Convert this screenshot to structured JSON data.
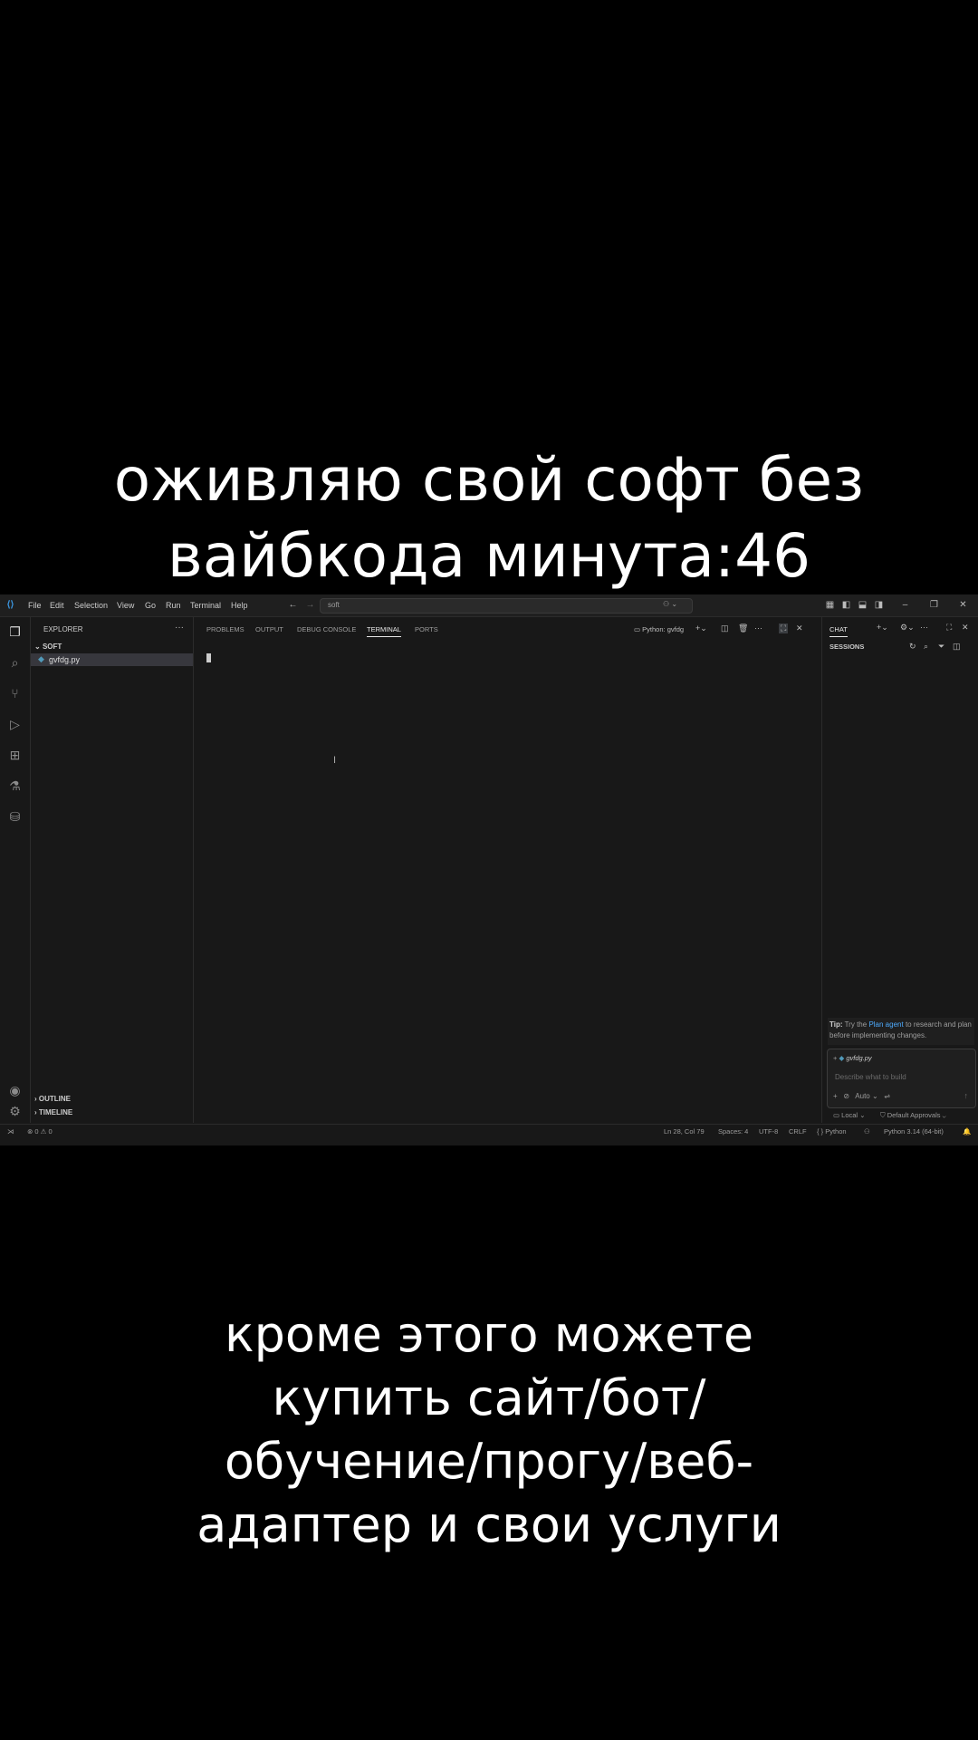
{
  "captions": {
    "top": [
      "оживляю свой софт без",
      "вайбкода минута:46"
    ],
    "bottom": [
      "кроме этого можете",
      "купить сайт/бот/",
      "обучение/прогу/веб-",
      "адаптер и свои услуги"
    ]
  },
  "titlebar": {
    "menu": [
      "File",
      "Edit",
      "Selection",
      "View",
      "Go",
      "Run",
      "Terminal",
      "Help"
    ],
    "search_value": "soft"
  },
  "sidebar": {
    "title": "EXPLORER",
    "folder": "SOFT",
    "file": "gvfdg.py",
    "sections": [
      "OUTLINE",
      "TIMELINE"
    ]
  },
  "panel": {
    "tabs": [
      "PROBLEMS",
      "OUTPUT",
      "DEBUG CONSOLE",
      "TERMINAL",
      "PORTS"
    ],
    "active_tab": "TERMINAL",
    "terminal_name": "Python: gvfdg"
  },
  "chat": {
    "tab": "CHAT",
    "sessions_label": "SESSIONS",
    "tip_label": "Tip:",
    "tip_pre": "Try the",
    "tip_link": "Plan agent",
    "tip_post": "to research and plan before implementing changes.",
    "attached_file": "gvfdg.py",
    "input_placeholder": "Describe what to build",
    "mode": "Auto",
    "location": "Local",
    "approvals": "Default Approvals"
  },
  "statusbar": {
    "errors": "0",
    "warnings": "0",
    "position": "Ln 28, Col 79",
    "spaces": "Spaces: 4",
    "encoding": "UTF-8",
    "eol": "CRLF",
    "language": "Python",
    "interpreter": "Python 3.14 (64-bit)"
  },
  "colors": {
    "background": "#000000",
    "ide_bg": "#181818",
    "accent": "#0078d4",
    "link": "#4daafc",
    "python_file_icon": "#519aba"
  }
}
